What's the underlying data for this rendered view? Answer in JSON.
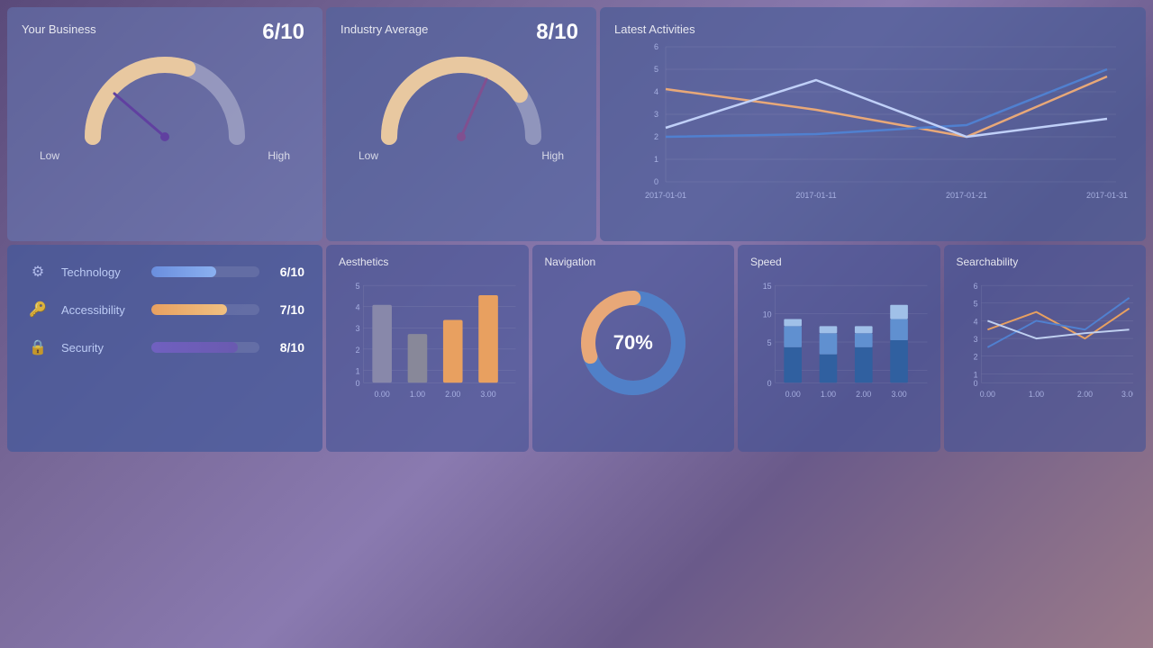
{
  "panels": {
    "yourBusiness": {
      "title": "Your Business",
      "score": "6/10",
      "low": "Low",
      "high": "High",
      "gaugeValue": 0.6
    },
    "industryAverage": {
      "title": "Industry Average",
      "score": "8/10",
      "low": "Low",
      "high": "High",
      "gaugeValue": 0.8
    },
    "latestActivities": {
      "title": "Latest Activities",
      "xLabels": [
        "2017-01-01",
        "2017-01-11",
        "2017-01-21",
        "2017-01-31"
      ],
      "yLabels": [
        "0",
        "1",
        "2",
        "3",
        "4",
        "5",
        "6"
      ],
      "series": [
        {
          "color": "#e8a878",
          "points": [
            4.2,
            3.2,
            2.0,
            4.7
          ]
        },
        {
          "color": "#6090e0",
          "points": [
            2.0,
            2.1,
            2.5,
            5.0
          ]
        },
        {
          "color": "#c0d0f0",
          "points": [
            2.4,
            4.5,
            2.0,
            2.8
          ]
        }
      ]
    },
    "metrics": {
      "items": [
        {
          "label": "Technology",
          "score": "6/10",
          "pct": 60,
          "icon": "⚙"
        },
        {
          "label": "Accessibility",
          "score": "7/10",
          "pct": 70,
          "icon": "🔑"
        },
        {
          "label": "Security",
          "score": "8/10",
          "pct": 80,
          "icon": "🔒"
        }
      ]
    },
    "aesthetics": {
      "title": "Aesthetics",
      "xLabels": [
        "0.00",
        "1.00",
        "2.00",
        "3.00"
      ],
      "yMax": 5,
      "bars": [
        {
          "x": 0,
          "value": 4.0,
          "color": "#888aaa"
        },
        {
          "x": 1,
          "value": 2.5,
          "color": "#888aaa"
        },
        {
          "x": 2,
          "value": 3.2,
          "color": "#e8a060"
        },
        {
          "x": 3,
          "value": 4.5,
          "color": "#e8a060"
        }
      ]
    },
    "navigation": {
      "title": "Navigation",
      "percent": "70%",
      "percentNum": 70
    },
    "speed": {
      "title": "Speed",
      "xLabels": [
        "0.00",
        "1.00",
        "2.00",
        "3.00"
      ],
      "yMax": 15,
      "barGroups": [
        {
          "x": 0,
          "bot": 5,
          "mid": 3,
          "top": 1
        },
        {
          "x": 1,
          "bot": 4,
          "mid": 3,
          "top": 1
        },
        {
          "x": 2,
          "bot": 5,
          "mid": 2,
          "top": 1
        },
        {
          "x": 3,
          "bot": 6,
          "mid": 3,
          "top": 2
        }
      ]
    },
    "searchability": {
      "title": "Searchability",
      "xLabels": [
        "0.00",
        "1.00",
        "2.00",
        "3.00"
      ],
      "yMax": 6,
      "series": [
        {
          "color": "#e8a060",
          "points": [
            3.0,
            4.0,
            2.5,
            4.2
          ]
        },
        {
          "color": "#5080d0",
          "points": [
            2.0,
            3.5,
            3.0,
            4.8
          ]
        },
        {
          "color": "#c0d0f0",
          "points": [
            3.5,
            2.5,
            2.8,
            3.0
          ]
        }
      ]
    }
  }
}
